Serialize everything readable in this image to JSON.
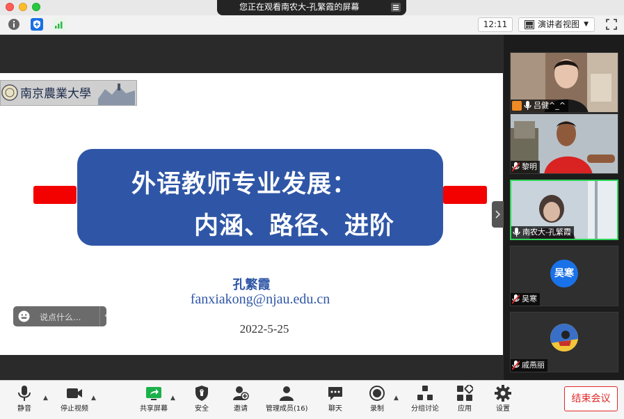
{
  "window": {
    "share_banner": "您正在观看南农大-孔繁霞的屏幕"
  },
  "toolbar": {
    "time": "12:11",
    "view_label": "演讲者视图"
  },
  "slide": {
    "title_line1": "外语教师专业发展：",
    "title_line2": "内涵、路径、进阶",
    "author": "孔繁霞",
    "email": "fanxiakong@njau.edu.cn",
    "date": "2022-5-25",
    "logo_text": "南京農業大學"
  },
  "chat_float": {
    "placeholder": "说点什么..."
  },
  "participants": [
    {
      "name": "吕健^_^",
      "muted": false,
      "host": true,
      "type": "video"
    },
    {
      "name": "黎明",
      "muted": true,
      "host": false,
      "type": "video"
    },
    {
      "name": "南农大-孔繁霞",
      "muted": false,
      "host": false,
      "type": "video",
      "active": true
    },
    {
      "name": "吴寒",
      "muted": true,
      "host": false,
      "type": "avatar",
      "avatar_text": "吴寒"
    },
    {
      "name": "戚燕丽",
      "muted": true,
      "host": false,
      "type": "image"
    }
  ],
  "controls": {
    "mute": "静音",
    "stop_video": "停止视频",
    "share_screen": "共享屏幕",
    "security": "安全",
    "invite": "邀请",
    "participants": "管理成员(16)",
    "chat": "聊天",
    "record": "录制",
    "breakout": "分组讨论",
    "apps": "应用",
    "settings": "设置",
    "end": "结束会议"
  },
  "colors": {
    "slide_blue": "#2f56a6",
    "accent_red": "#f30000",
    "active_green": "#2fd65a",
    "end_red": "#e02828"
  }
}
